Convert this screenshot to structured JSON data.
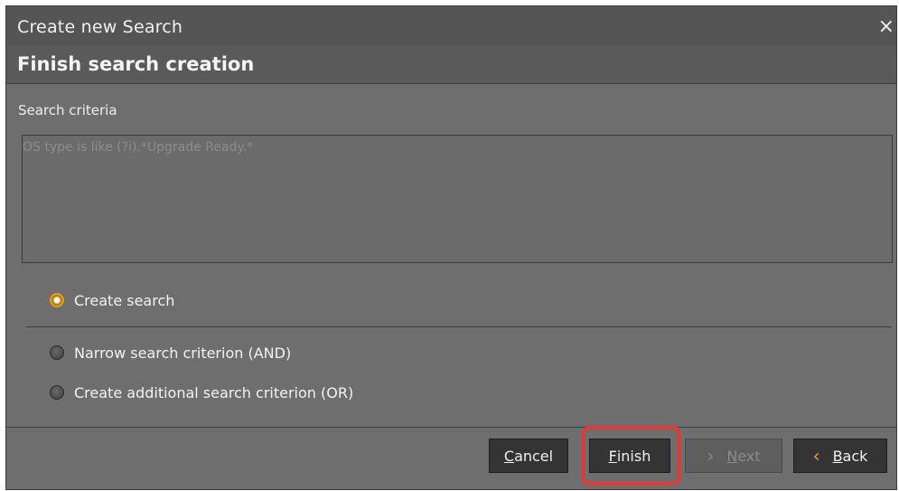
{
  "window": {
    "title": "Create new Search",
    "close_glyph": "×"
  },
  "header": {
    "title": "Finish search creation"
  },
  "criteria": {
    "label": "Search criteria",
    "value": "OS type is like (?i).*Upgrade Ready.*"
  },
  "options": [
    {
      "label": "Create search",
      "checked": true
    },
    {
      "label": "Narrow search criterion (AND)",
      "checked": false
    },
    {
      "label": "Create additional search criterion (OR)",
      "checked": false
    }
  ],
  "buttons": {
    "cancel": {
      "mnemonic": "C",
      "rest": "ancel",
      "enabled": true
    },
    "finish": {
      "mnemonic": "F",
      "rest": "inish",
      "enabled": true
    },
    "next": {
      "chevron": "›",
      "mnemonic": "N",
      "rest": "ext",
      "enabled": false
    },
    "back": {
      "chevron": "‹",
      "mnemonic": "B",
      "rest": "ack",
      "enabled": true
    }
  },
  "colors": {
    "window_bg": "#6e6e6e",
    "titlebar_bg": "#555555",
    "radio_accent": "#e0a020",
    "highlight": "#e03a3a"
  }
}
